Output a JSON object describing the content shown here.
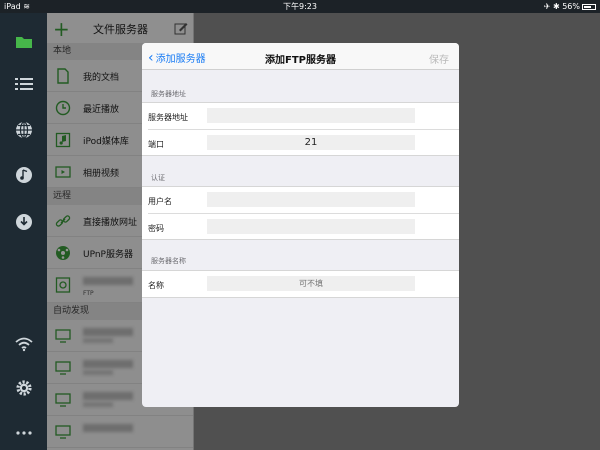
{
  "status_bar": {
    "device": "iPad",
    "time": "下午9:23",
    "battery": "56%"
  },
  "rail": {
    "items": [
      "folder-icon",
      "list-icon",
      "globe-icon",
      "music-icon",
      "download-icon",
      "wifi-icon",
      "gear-icon",
      "more-icon"
    ]
  },
  "sidebar": {
    "title": "文件服务器",
    "sections": {
      "local": "本地",
      "remote": "远程",
      "auto": "自动发现"
    },
    "local_items": [
      "我的文档",
      "最近播放",
      "iPod媒体库",
      "相册视频"
    ],
    "remote_items": [
      "直接播放网址",
      "UPnP服务器"
    ],
    "ftp_sub": "FTP"
  },
  "modal": {
    "back_label": "添加服务器",
    "title": "添加FTP服务器",
    "save_label": "保存",
    "groups": {
      "server_address": "服务器地址",
      "auth": "认证",
      "server_name": "服务器名称"
    },
    "fields": {
      "address_label": "服务器地址",
      "address_value": "",
      "port_label": "端口",
      "port_value": "21",
      "username_label": "用户名",
      "username_value": "",
      "password_label": "密码",
      "password_value": "",
      "name_label": "名称",
      "name_placeholder": "可不填"
    }
  },
  "colors": {
    "accent": "#1a7cf4",
    "brand_green": "#3c9d3c",
    "rail_bg": "#1e2a33"
  }
}
